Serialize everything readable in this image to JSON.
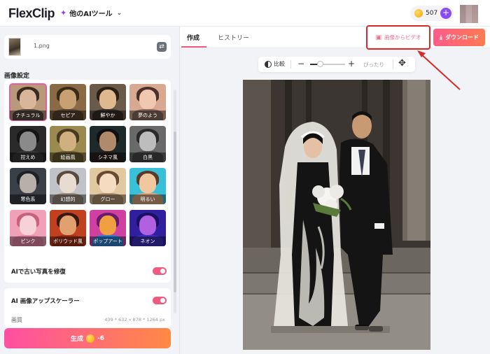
{
  "header": {
    "logo": "FlexClip",
    "ai_tools_label": "他のAIツール",
    "credits": "507"
  },
  "left": {
    "file_name": "1.png",
    "section_title": "画像設定",
    "styles": [
      {
        "label": "ナチュラル",
        "bg": "#b89a7a",
        "hair": "#3a2a20",
        "face": "#d9b69a",
        "body": "#5a4a40",
        "selected": true
      },
      {
        "label": "セピア",
        "bg": "#8a6a44",
        "hair": "#3a2a18",
        "face": "#c9a072",
        "body": "#5a4430",
        "selected": false
      },
      {
        "label": "鮮やか",
        "bg": "#6a5a4a",
        "hair": "#2a1e16",
        "face": "#e0b890",
        "body": "#3a2e28",
        "selected": false
      },
      {
        "label": "夢のよう",
        "bg": "#d8a890",
        "hair": "#4a3028",
        "face": "#f0c8b0",
        "body": "#8a6a60",
        "selected": false
      },
      {
        "label": "控えめ",
        "bg": "#2a2a2a",
        "hair": "#151515",
        "face": "#8a8a8a",
        "body": "#3a3a3a",
        "selected": false
      },
      {
        "label": "絵画風",
        "bg": "#9a8a50",
        "hair": "#4a3a20",
        "face": "#d0b080",
        "body": "#6a5a30",
        "selected": false
      },
      {
        "label": "シネマ風",
        "bg": "#1e2a2a",
        "hair": "#101010",
        "face": "#b08a6a",
        "body": "#2a2020",
        "selected": false
      },
      {
        "label": "白黒",
        "bg": "#6a6a6a",
        "hair": "#2a2a2a",
        "face": "#bdbdbd",
        "body": "#4a4a4a",
        "selected": false
      },
      {
        "label": "寒色系",
        "bg": "#3a4048",
        "hair": "#1e2228",
        "face": "#b8b0a8",
        "body": "#3a3c44",
        "selected": false
      },
      {
        "label": "幻想的",
        "bg": "#c0c4c8",
        "hair": "#5a4a40",
        "face": "#e8dcd0",
        "body": "#9a8a80",
        "selected": false
      },
      {
        "label": "グロー",
        "bg": "#e0c8a0",
        "hair": "#6a4a30",
        "face": "#f4dcc0",
        "body": "#b09070",
        "selected": false
      },
      {
        "label": "明るい",
        "bg": "#38c0d8",
        "hair": "#5a3a28",
        "face": "#f0c8a0",
        "body": "#d8a880",
        "selected": false
      },
      {
        "label": "ピンク",
        "bg": "#f0a0b8",
        "hair": "#c86080",
        "face": "#f8d0d8",
        "body": "#e888a8",
        "selected": false
      },
      {
        "label": "ボリウッド風",
        "bg": "#c04020",
        "hair": "#3a1a10",
        "face": "#e0a070",
        "body": "#a03018",
        "selected": false
      },
      {
        "label": "ポップアート",
        "bg": "#d040a0",
        "hair": "#6a1a6a",
        "face": "#f0a040",
        "body": "#3080d0",
        "selected": false
      },
      {
        "label": "ネオン",
        "bg": "#3020a0",
        "hair": "#1a1060",
        "face": "#b060e0",
        "body": "#4030c0",
        "selected": false
      }
    ],
    "restore_label": "AIで古い写真を修復",
    "restore_enabled": true,
    "upscaler_label": "AI 画像アップスケーラー",
    "upscaler_enabled": true,
    "quality_label": "画質",
    "quality_values": "439 * 632 » 878 * 1264 px",
    "generate_label": "生成",
    "generate_cost": "-6"
  },
  "tabs": [
    {
      "label": "作成",
      "active": true
    },
    {
      "label": "ヒストリー",
      "active": false
    }
  ],
  "actions": {
    "img2video_label": "画像からビデオ",
    "download_label": "ダウンロード"
  },
  "zoom": {
    "compare_label": "比較",
    "fit_label": "ぴったり",
    "level": 0.28
  },
  "colors": {
    "accent": "#f05a7e",
    "gradient_start": "#ff4fa3",
    "gradient_end": "#ff8a45",
    "highlight": "#d42a2a"
  }
}
